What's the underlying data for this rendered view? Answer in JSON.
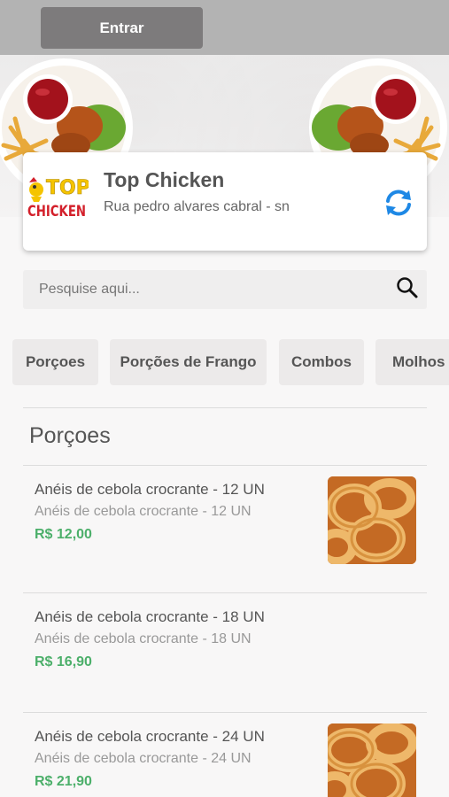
{
  "header": {
    "enter_label": "Entrar"
  },
  "store": {
    "name": "Top Chicken",
    "address": "Rua pedro alvares cabral - sn",
    "logo_line1": "TOP",
    "logo_line2": "CHICKEN"
  },
  "search": {
    "placeholder": "Pesquise aqui..."
  },
  "categories": [
    {
      "label": "Porçoes"
    },
    {
      "label": "Porções de Frango"
    },
    {
      "label": "Combos"
    },
    {
      "label": "Molhos"
    }
  ],
  "section": {
    "title": "Porçoes"
  },
  "products": [
    {
      "title": "Anéis de cebola crocrante - 12 UN",
      "description": "Anéis de cebola crocrante - 12 UN",
      "price": "R$ 12,00",
      "has_image": true
    },
    {
      "title": "Anéis de cebola crocrante - 18 UN",
      "description": "Anéis de cebola crocrante - 18 UN",
      "price": "R$ 16,90",
      "has_image": false
    },
    {
      "title": "Anéis de cebola crocrante - 24 UN",
      "description": "Anéis de cebola crocrante - 24 UN",
      "price": "R$ 21,90",
      "has_image": true
    }
  ],
  "colors": {
    "price": "#4caf6a",
    "refresh_icon": "#1e88e5",
    "logo_yellow": "#f5c400",
    "logo_red": "#d3202b"
  },
  "icons": {
    "refresh": "refresh-icon",
    "search": "search-icon"
  }
}
